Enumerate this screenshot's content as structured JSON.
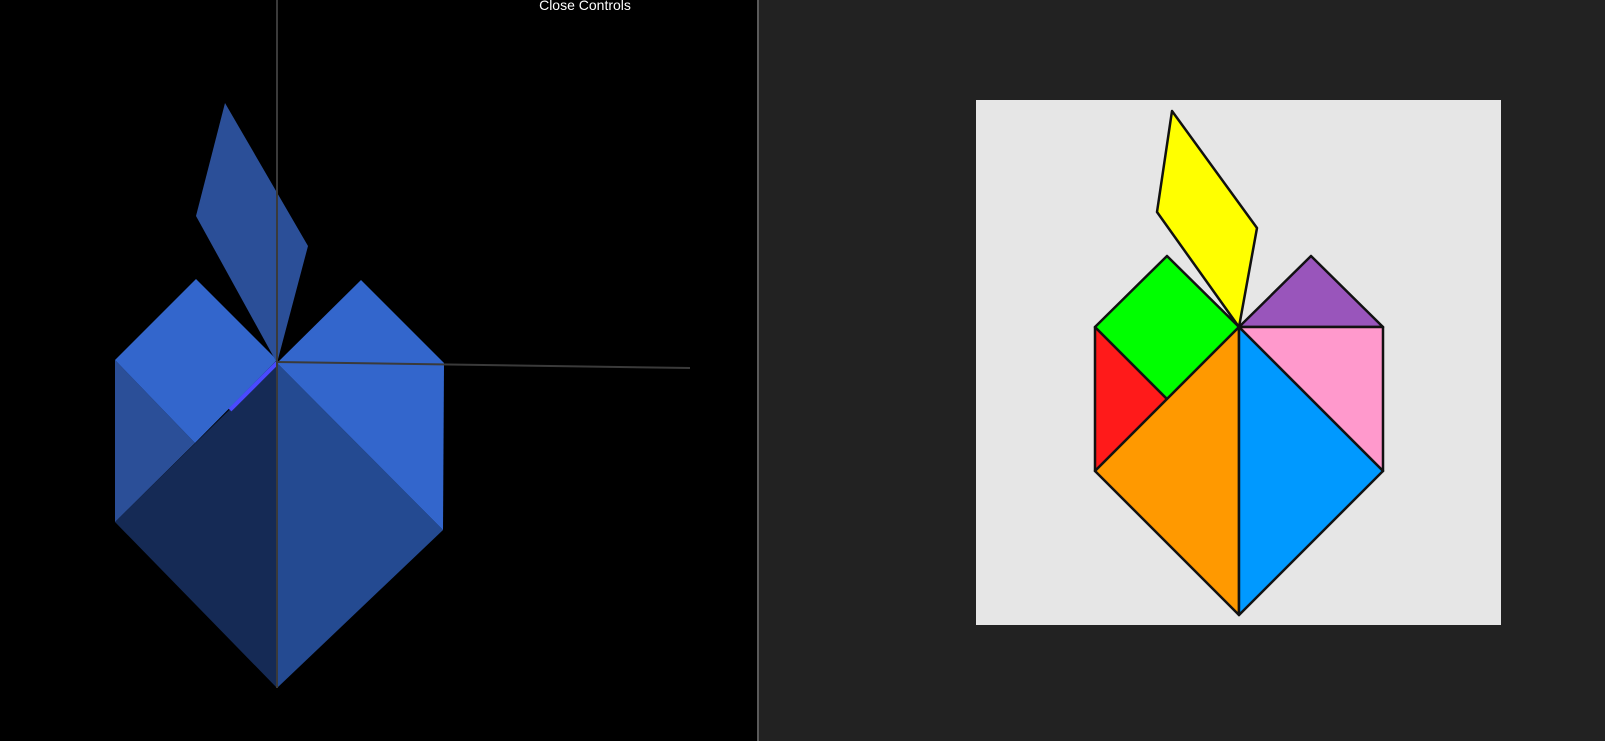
{
  "viewer": {
    "controls_label": "Close Controls",
    "piece_color": "#3366cc",
    "axis_color": "#3a3a3a"
  },
  "target": {
    "background": "#e6e6e6",
    "pieces": [
      {
        "name": "small-triangle",
        "color": "#ff1a1a"
      },
      {
        "name": "square",
        "color": "#00ff00"
      },
      {
        "name": "parallelogram",
        "color": "#ffff00"
      },
      {
        "name": "small-triangle",
        "color": "#9955bb"
      },
      {
        "name": "medium-triangle",
        "color": "#ff99cc"
      },
      {
        "name": "large-triangle",
        "color": "#ff9900"
      },
      {
        "name": "large-triangle",
        "color": "#0099ff"
      }
    ]
  }
}
